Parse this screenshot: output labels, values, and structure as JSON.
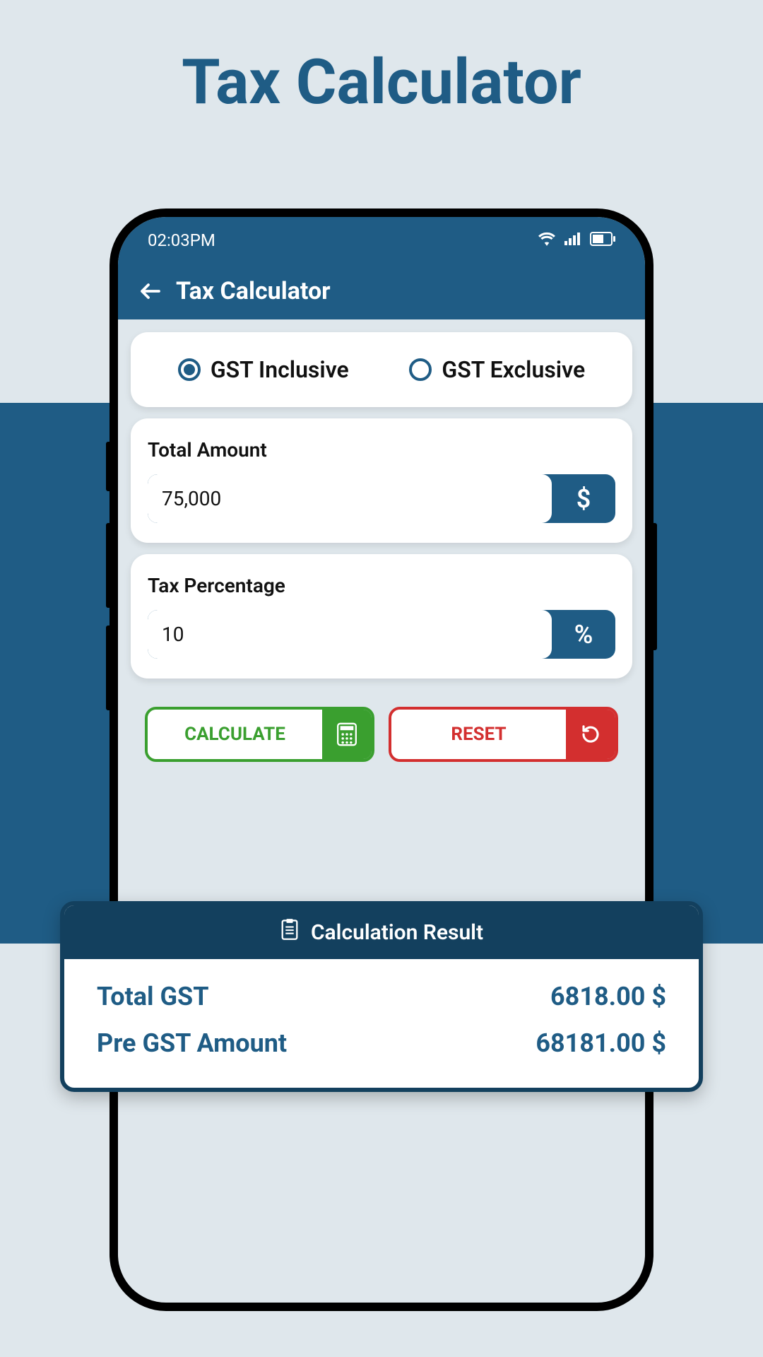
{
  "page": {
    "title": "Tax Calculator"
  },
  "statusBar": {
    "time": "02:03PM"
  },
  "header": {
    "title": "Tax Calculator"
  },
  "mode": {
    "options": [
      {
        "label": "GST Inclusive",
        "selected": true
      },
      {
        "label": "GST Exclusive",
        "selected": false
      }
    ]
  },
  "fields": {
    "amount": {
      "label": "Total Amount",
      "value": "75,000",
      "unit": "$"
    },
    "percentage": {
      "label": "Tax Percentage",
      "value": "10",
      "unit": "%"
    }
  },
  "buttons": {
    "calculate": "CALCULATE",
    "reset": "RESET"
  },
  "result": {
    "title": "Calculation Result",
    "rows": [
      {
        "label": "Total GST",
        "value": "6818.00 $"
      },
      {
        "label": "Pre GST Amount",
        "value": "68181.00 $"
      }
    ]
  }
}
